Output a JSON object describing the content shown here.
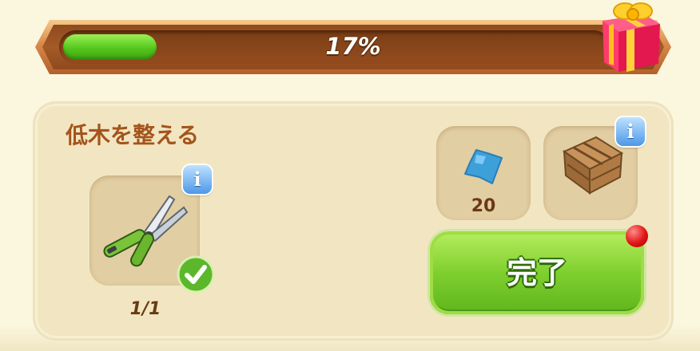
{
  "progress": {
    "percent_text": "17%",
    "fraction": 0.17
  },
  "task": {
    "title": "低木を整える",
    "tool": {
      "icon": "pruning-shears-icon",
      "count": "1/1",
      "status": "completed"
    },
    "rewards": [
      {
        "icon": "blue-gem-icon",
        "amount": "20"
      },
      {
        "icon": "wooden-crate-icon"
      }
    ],
    "complete_button_label": "完了",
    "info_glyph": "i"
  },
  "colors": {
    "progress_fill": "#55c71c",
    "button_green": "#7fcf2f",
    "title_brown": "#a4541c",
    "panel_bg": "#f1e6c1",
    "notification_red": "#e01515"
  }
}
